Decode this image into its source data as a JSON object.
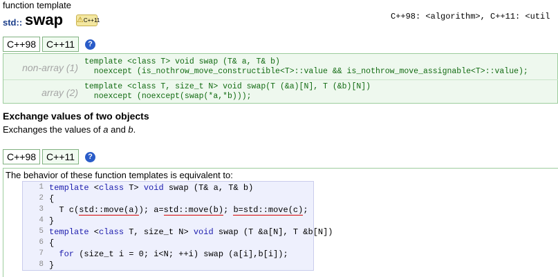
{
  "header": {
    "kind_label": "function template",
    "namespace": "std::",
    "function_name": "swap",
    "badge_text": "C++11",
    "headers_text": "C++98: <algorithm>, C++11: <util"
  },
  "tabs_top": [
    {
      "label": "C++98",
      "active": false
    },
    {
      "label": "C++11",
      "active": true
    }
  ],
  "declarations": [
    {
      "label": "non-array (1)",
      "lines": [
        "template <class T> void swap (T& a, T& b)",
        "  noexcept (is_nothrow_move_constructible<T>::value && is_nothrow_move_assignable<T>::value);"
      ]
    },
    {
      "label": "array (2)",
      "lines": [
        "template <class T, size_t N> void swap(T (&a)[N], T (&b)[N])",
        "  noexcept (noexcept(swap(*a,*b)));"
      ]
    }
  ],
  "section": {
    "title": "Exchange values of two objects",
    "desc_prefix": "Exchanges the values of ",
    "desc_a": "a",
    "desc_and": " and ",
    "desc_b": "b",
    "desc_suffix": "."
  },
  "tabs_bottom": [
    {
      "label": "C++98",
      "active": false
    },
    {
      "label": "C++11",
      "active": true
    }
  ],
  "equivalent_text": "The behavior of these function templates is equivalent to:",
  "code_lines": [
    {
      "n": "1",
      "text": "template <class T> void swap (T& a, T& b)"
    },
    {
      "n": "2",
      "text": "{"
    },
    {
      "n": "3",
      "text": "  T c(std::move(a)); a=std::move(b); b=std::move(c);"
    },
    {
      "n": "4",
      "text": "}"
    },
    {
      "n": "5",
      "text": "template <class T, size_t N> void swap (T &a[N], T &b[N])"
    },
    {
      "n": "6",
      "text": "{"
    },
    {
      "n": "7",
      "text": "  for (size_t i = 0; i<N; ++i) swap (a[i],b[i]);"
    },
    {
      "n": "8",
      "text": "}"
    }
  ],
  "colors": {
    "accent_green": "#9ccc9c",
    "decl_green_text": "#126b12",
    "code_bg": "#eef0fd",
    "help_blue": "#2a5cc8"
  }
}
